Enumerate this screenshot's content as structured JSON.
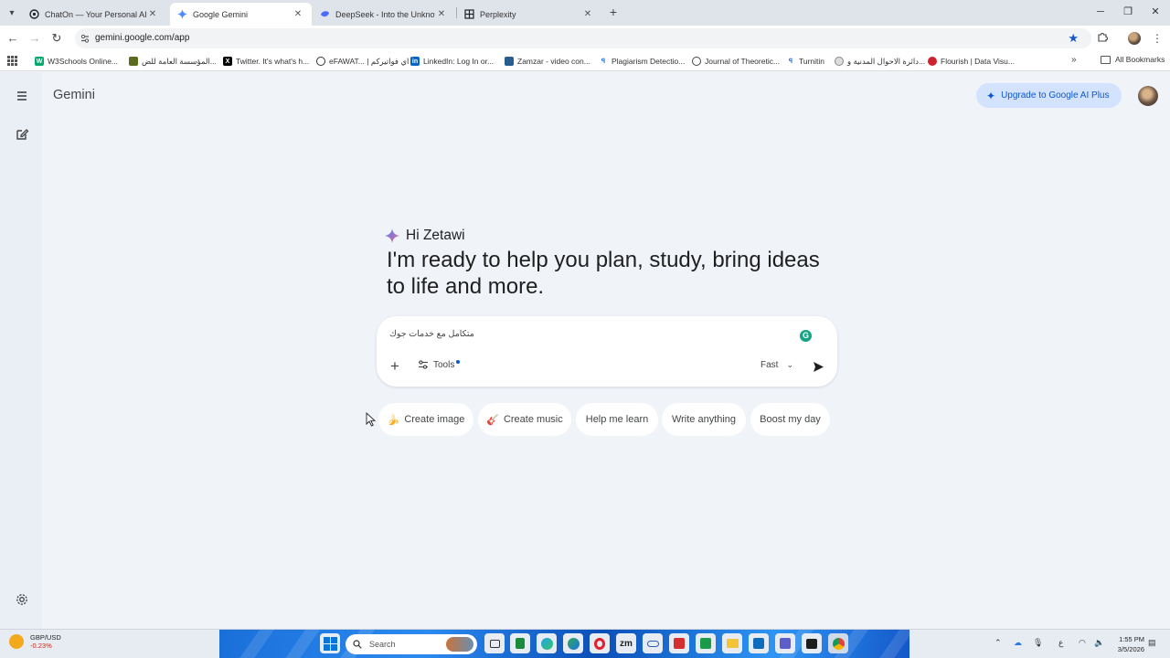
{
  "browser": {
    "tabs": [
      {
        "label": "ChatOn — Your Personal AI Ass",
        "icon": "chaton-icon",
        "active": false
      },
      {
        "label": "Google Gemini",
        "icon": "gemini-spark-icon",
        "active": true
      },
      {
        "label": "DeepSeek - Into the Unknown",
        "icon": "deepseek-icon",
        "active": false
      },
      {
        "label": "Perplexity",
        "icon": "perplexity-icon",
        "active": false
      }
    ],
    "url": "gemini.google.com/app",
    "bookmarks": [
      {
        "label": "W3Schools Online...",
        "color": "#04aa6d"
      },
      {
        "label": "المؤسسة العامة للض...",
        "color": "#5b6b1f"
      },
      {
        "label": "Twitter. It's what's h...",
        "color": "#000000"
      },
      {
        "label": "eFAWAT... | اي فواتيركم",
        "color": "#333333"
      },
      {
        "label": "LinkedIn: Log In or...",
        "color": "#0a66c2"
      },
      {
        "label": "Zamzar - video con...",
        "color": "#2a5d8f"
      },
      {
        "label": "Plagiarism Detectio...",
        "color": "#1a73e8"
      },
      {
        "label": "Journal of Theoretic...",
        "color": "#444444"
      },
      {
        "label": "Turnitin",
        "color": "#1a73e8"
      },
      {
        "label": "دائرة الاحوال المدنية و...",
        "color": "#888888"
      },
      {
        "label": "Flourish | Data Visu...",
        "color": "#d0222e"
      }
    ],
    "all_bookmarks": "All Bookmarks"
  },
  "app": {
    "title": "Gemini",
    "upgrade_label": "Upgrade to Google AI Plus",
    "greeting": "Hi Zetawi",
    "headline": "I'm ready to help you plan, study, bring ideas to life and more.",
    "prompt_text": "متكامل مع خدمات جوك",
    "tools_label": "Tools",
    "mode_label": "Fast",
    "chips": [
      {
        "label": "Create image",
        "emoji": "🍌"
      },
      {
        "label": "Create music",
        "emoji": "🎸"
      },
      {
        "label": "Help me learn",
        "emoji": ""
      },
      {
        "label": "Write anything",
        "emoji": ""
      },
      {
        "label": "Boost my day",
        "emoji": ""
      }
    ],
    "accent_color": "#0b57d0"
  },
  "taskbar": {
    "fx_title": "GBP/USD",
    "fx_value": "-0.23%",
    "search_placeholder": "Search",
    "lang_indicator": "ع",
    "time": "1:55 PM",
    "date": "3/5/2026"
  }
}
